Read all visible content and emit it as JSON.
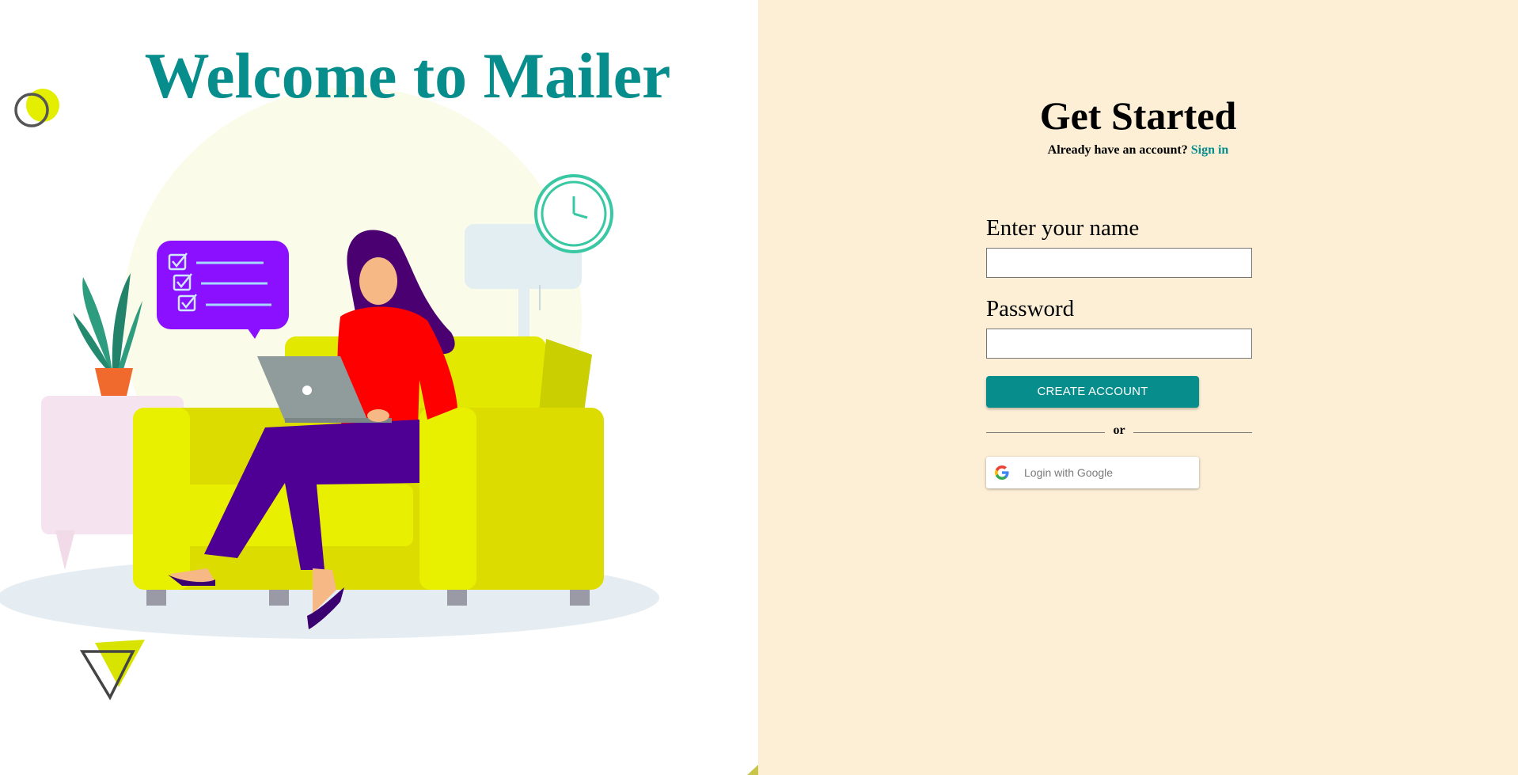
{
  "hero": {
    "title": "Welcome to Mailer"
  },
  "form": {
    "title": "Get Started",
    "subtitle_prefix": "Already have an account?",
    "signin_link": "Sign in",
    "name_label": "Enter your name",
    "name_value": "",
    "password_label": "Password",
    "password_value": "",
    "create_button": "CREATE ACCOUNT",
    "or_text": "or",
    "google_button": "Login with Google"
  },
  "colors": {
    "accent": "#078d8c",
    "right_bg": "#fcefd6",
    "sofa": "#e3e800",
    "sweater": "#ff0000",
    "pants": "#4e0094",
    "bubble": "#8a10ff"
  }
}
